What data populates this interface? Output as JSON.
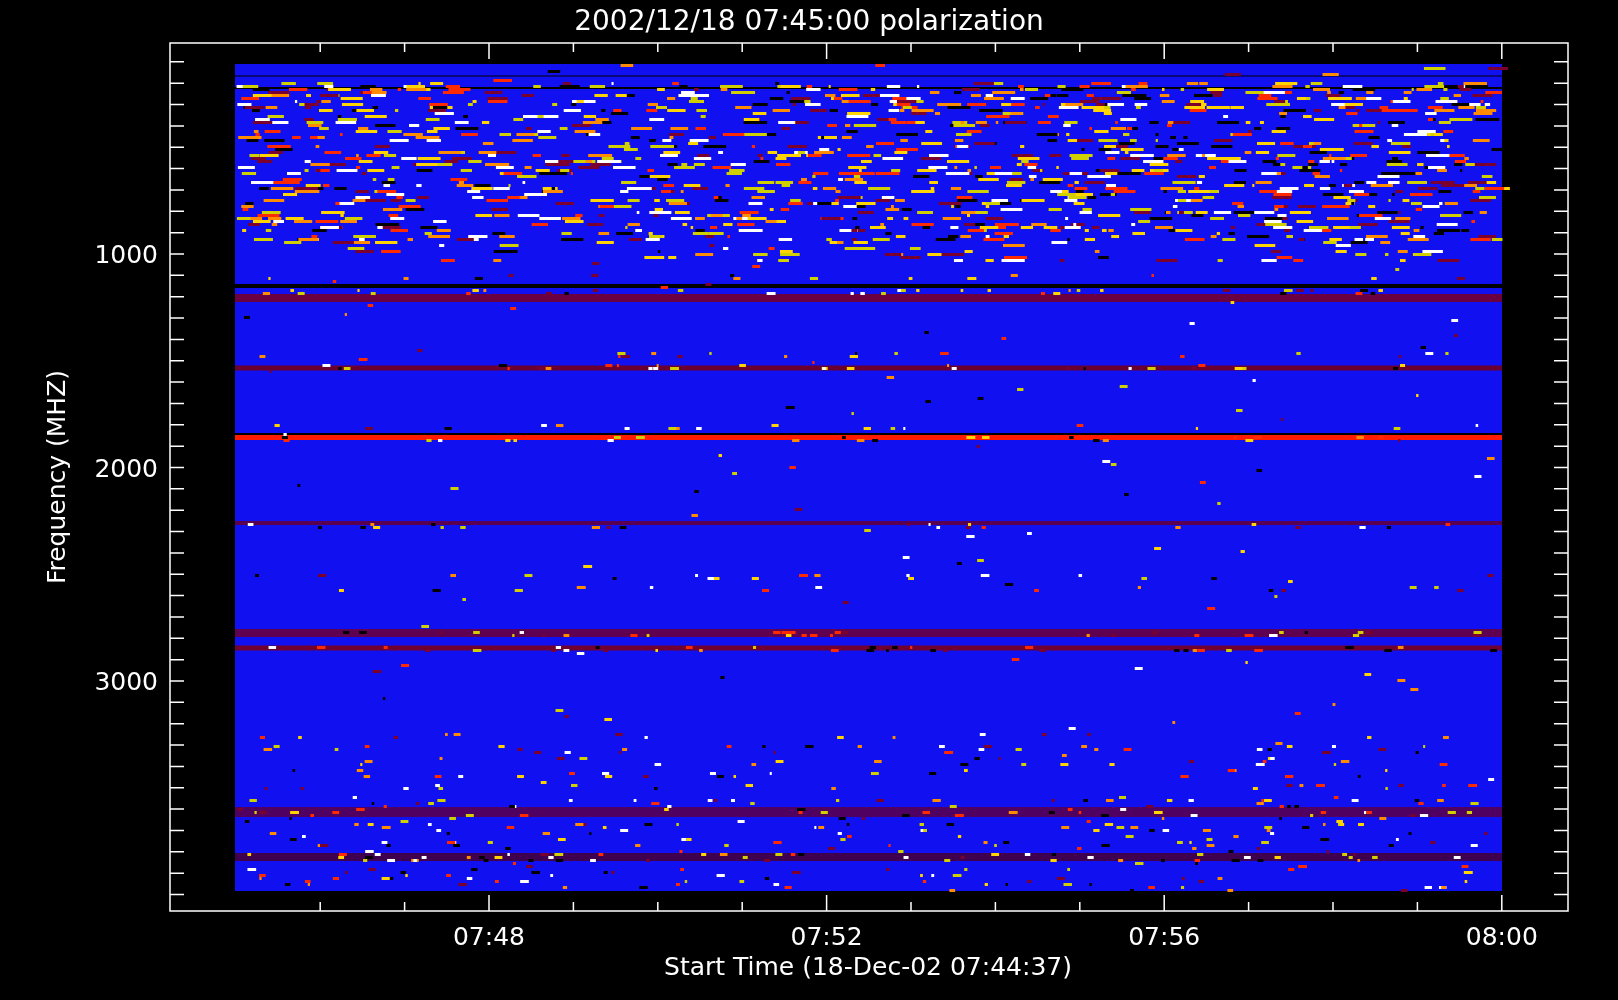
{
  "title": "2002/12/18 07:45:00 polarization",
  "ylabel": "Frequency (MHZ)",
  "xlabel": "Start Time (18-Dec-02 07:44:37)",
  "yticks": [
    {
      "label": "1000"
    },
    {
      "label": "2000"
    },
    {
      "label": "3000"
    }
  ],
  "xticks": [
    {
      "label": "07:48"
    },
    {
      "label": "07:52"
    },
    {
      "label": "07:56"
    },
    {
      "label": "08:00"
    }
  ]
}
